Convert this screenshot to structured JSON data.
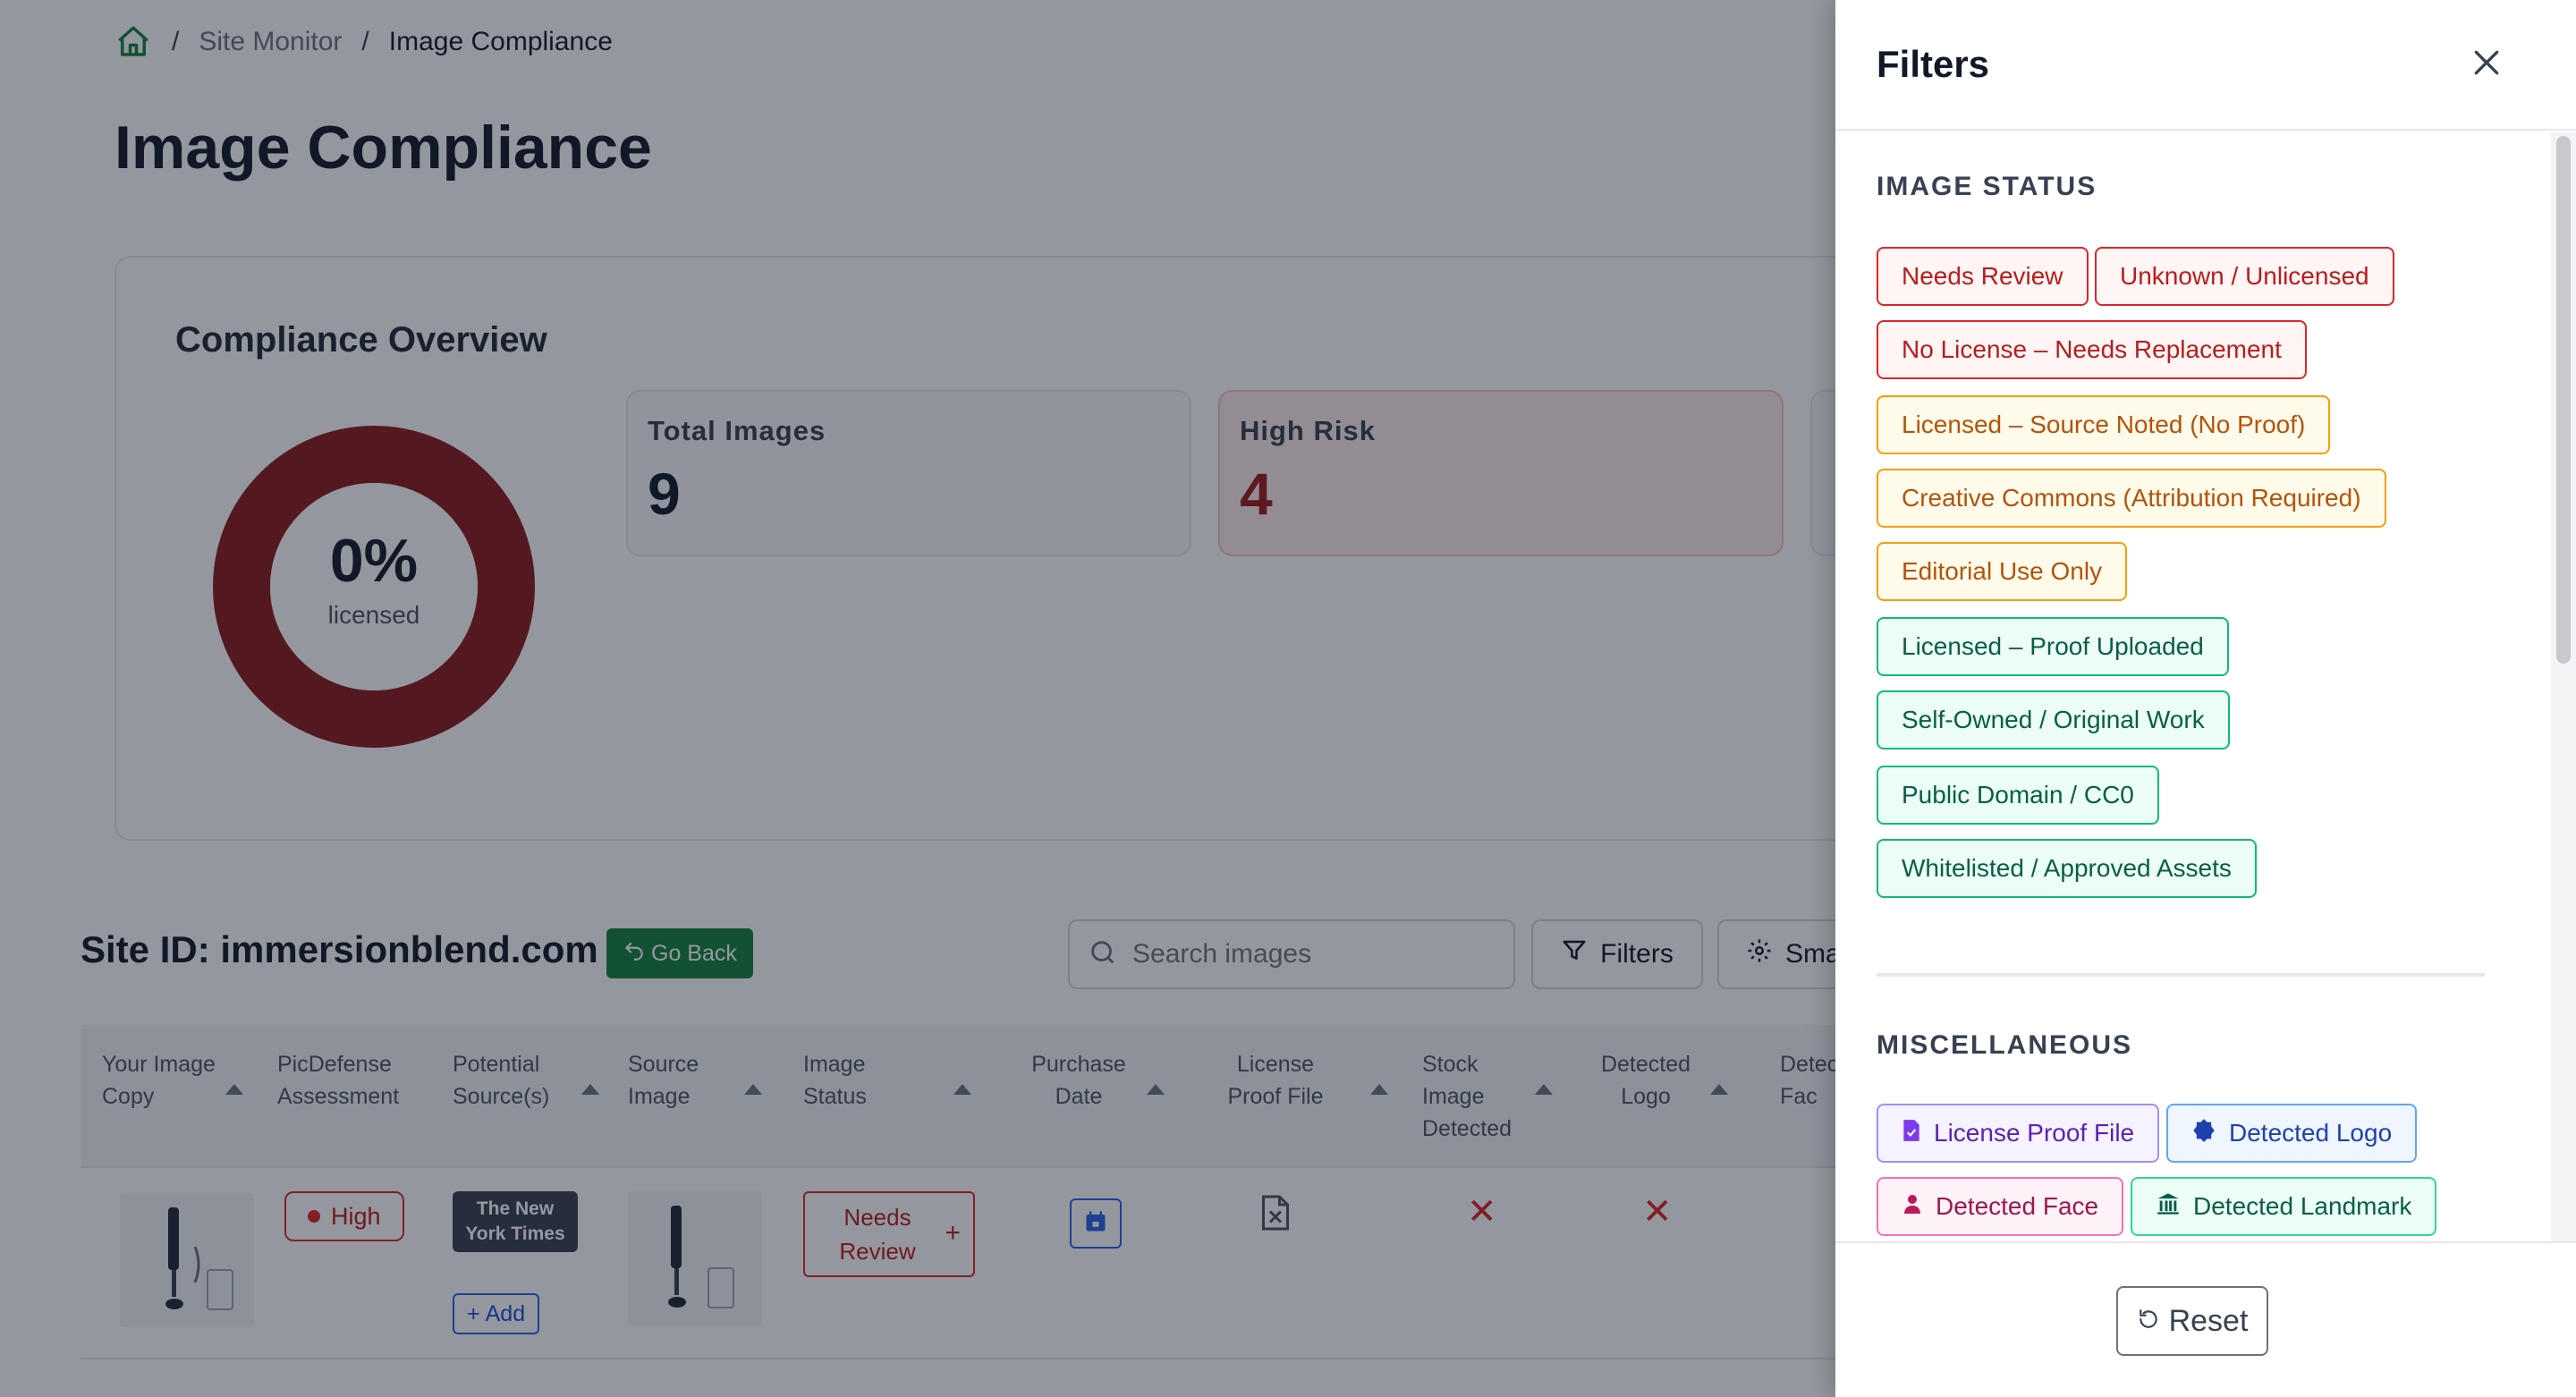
{
  "breadcrumb": {
    "site_monitor": "Site Monitor",
    "current": "Image Compliance",
    "separator": "/"
  },
  "page": {
    "title": "Image Compliance"
  },
  "overview": {
    "title": "Compliance Overview",
    "licensed_pct": "0%",
    "licensed_label": "licensed",
    "stats": [
      {
        "label": "Total Images",
        "value": "9"
      },
      {
        "label": "High Risk",
        "value": "4"
      }
    ]
  },
  "toolbar": {
    "site_id": "Site ID: immersionblend.com",
    "go_back": "Go Back",
    "search_placeholder": "Search images",
    "filters": "Filters",
    "smart": "Sma"
  },
  "table": {
    "columns": [
      "Your Image Copy",
      "PicDefense Assessment",
      "Potential Source(s)",
      "Source Image",
      "Image Status",
      "Purchase Date",
      "License Proof File",
      "Stock Image Detected",
      "Detected Logo",
      "Detec Fac"
    ],
    "row1": {
      "assessment": "High",
      "source": "The New York Times",
      "add": "Add",
      "status": "Needs Review",
      "status_plus": "+",
      "stock": "✕",
      "logo": "✕"
    }
  },
  "drawer": {
    "title": "Filters",
    "image_status_title": "IMAGE STATUS",
    "image_status": [
      "Needs Review",
      "Unknown / Unlicensed",
      "No License – Needs Replacement",
      "Licensed – Source Noted (No Proof)",
      "Creative Commons (Attribution Required)",
      "Editorial Use Only",
      "Licensed – Proof Uploaded",
      "Self-Owned / Original Work",
      "Public Domain / CC0",
      "Whitelisted / Approved Assets"
    ],
    "misc_title": "MISCELLANEOUS",
    "misc": [
      "License Proof File",
      "Detected Logo",
      "Detected Face",
      "Detected Landmark"
    ],
    "reset": "Reset"
  },
  "colors": {
    "brand_green": "#15803d",
    "danger": "#dc2626",
    "donut": "#8b1a1a"
  }
}
